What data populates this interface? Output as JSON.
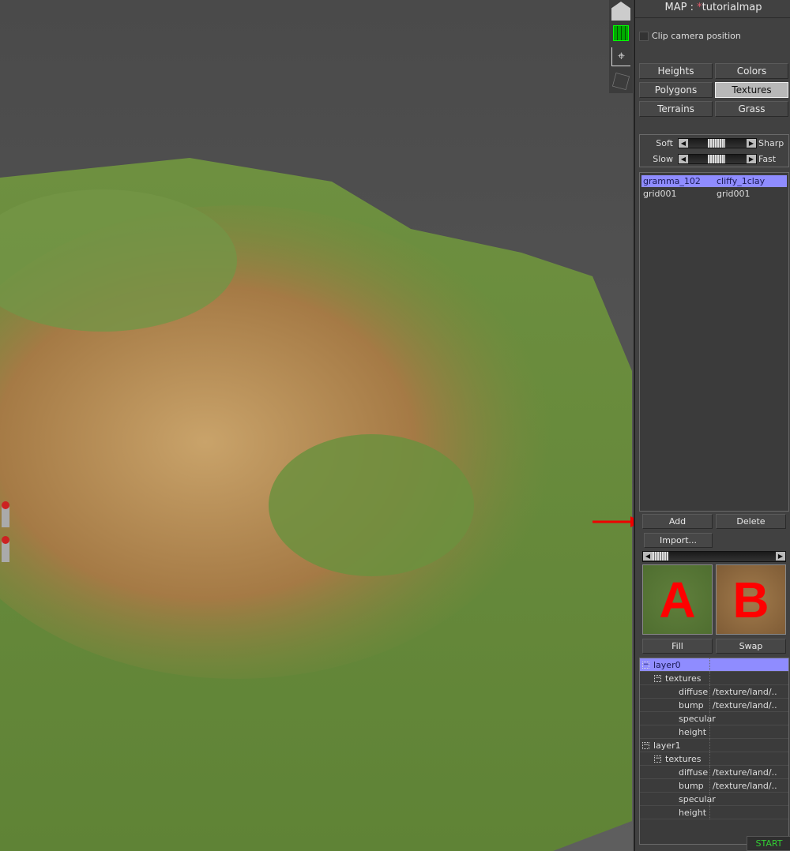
{
  "map": {
    "label": "MAP :",
    "modified_marker": "*",
    "name": "tutorialmap"
  },
  "clip_camera": {
    "label": "Clip camera position",
    "checked": false
  },
  "modes": [
    {
      "label": "Heights",
      "active": false
    },
    {
      "label": "Colors",
      "active": false
    },
    {
      "label": "Polygons",
      "active": false
    },
    {
      "label": "Textures",
      "active": true
    },
    {
      "label": "Terrains",
      "active": false
    },
    {
      "label": "Grass",
      "active": false
    }
  ],
  "sliders": [
    {
      "left": "Soft",
      "right": "Sharp",
      "value": 0.5
    },
    {
      "left": "Slow",
      "right": "Fast",
      "value": 0.5
    }
  ],
  "texture_list": [
    {
      "a": "gramma_102",
      "b": "cliffy_1clay",
      "selected": true
    },
    {
      "a": "grid001",
      "b": "grid001",
      "selected": false
    }
  ],
  "buttons": {
    "add": "Add",
    "delete": "Delete",
    "import": "Import...",
    "fill": "Fill",
    "swap": "Swap",
    "start": "START"
  },
  "tiles": {
    "a": "A",
    "b": "B"
  },
  "tree": [
    {
      "name": "layer0",
      "level": 0,
      "toggle": "−",
      "selected": true,
      "value": ""
    },
    {
      "name": "textures",
      "level": 1,
      "toggle": "−",
      "value": ""
    },
    {
      "name": "diffuse",
      "level": 2,
      "value": "/texture/land/.."
    },
    {
      "name": "bump",
      "level": 2,
      "value": "/texture/land/.."
    },
    {
      "name": "specular",
      "level": 2,
      "value": ""
    },
    {
      "name": "height",
      "level": 2,
      "value": ""
    },
    {
      "name": "layer1",
      "level": 0,
      "toggle": "−",
      "value": ""
    },
    {
      "name": "textures",
      "level": 1,
      "toggle": "−",
      "value": ""
    },
    {
      "name": "diffuse",
      "level": 2,
      "value": "/texture/land/.."
    },
    {
      "name": "bump",
      "level": 2,
      "value": "/texture/land/.."
    },
    {
      "name": "specular",
      "level": 2,
      "value": ""
    },
    {
      "name": "height",
      "level": 2,
      "value": ""
    }
  ],
  "toolbar_icons": [
    "house-icon",
    "grid-icon",
    "camera-path-icon",
    "cube-icon"
  ],
  "colors": {
    "selection": "#8f8cff",
    "annotation": "#ff0000",
    "start": "#33cc33"
  }
}
